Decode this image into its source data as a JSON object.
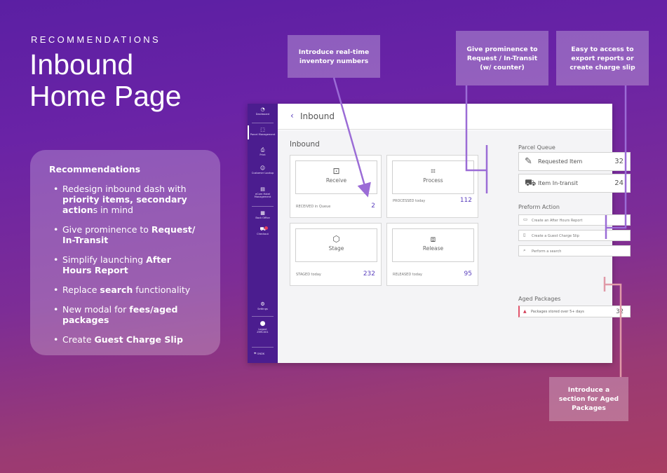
{
  "slide": {
    "eyebrow": "RECOMMENDATIONS",
    "title_line1": "Inbound",
    "title_line2": "Home Page"
  },
  "recommendations": {
    "heading": "Recommendations",
    "items": [
      {
        "pre": "Redesign inbound dash with ",
        "bold": "priority items, secondary action",
        "post": "s in mind"
      },
      {
        "pre": "Give prominence to ",
        "bold": "Request/ In-Transit",
        "post": ""
      },
      {
        "pre": "Simplify launching ",
        "bold": "After Hours Report",
        "post": ""
      },
      {
        "pre": "Replace ",
        "bold": "search",
        "post": " functionality"
      },
      {
        "pre": "New modal for ",
        "bold": "fees/aged packages",
        "post": ""
      },
      {
        "pre": "Create ",
        "bold": "Guest Charge Slip",
        "post": ""
      }
    ]
  },
  "callouts": {
    "realtime": "Introduce real-time inventory numbers",
    "prominence": "Give prominence to Request / In-Transit (w/ counter)",
    "export": "Easy to access to export reports or create charge slip",
    "aged": "Introduce a section for Aged Packages"
  },
  "app": {
    "sidebar": [
      {
        "label": "Dashboard",
        "icon": "dashboard-icon",
        "glyph": "◔"
      },
      {
        "label": "Parcel Management",
        "icon": "parcel-icon",
        "glyph": "⬚"
      },
      {
        "label": "Print",
        "icon": "print-icon",
        "glyph": "⎙"
      },
      {
        "label": "Customer Lookup",
        "icon": "customer-icon",
        "glyph": "☺"
      },
      {
        "label": "eCom Hotel Management",
        "icon": "hotel-icon",
        "glyph": "▤"
      },
      {
        "label": "Back Office",
        "icon": "back-office-icon",
        "glyph": "▦"
      },
      {
        "label": "Checkout",
        "icon": "cart-icon",
        "glyph": "⛟"
      },
      {
        "label": "Settings",
        "icon": "settings-icon",
        "glyph": "⚙"
      },
      {
        "label": "Logout",
        "icon": "avatar-icon",
        "glyph": "●"
      },
      {
        "label": "ONDK",
        "icon": "location-icon",
        "glyph": "⌖"
      }
    ],
    "logout_user": "ZERC001",
    "topbar_title": "Inbound",
    "inbound_heading": "Inbound",
    "cards": [
      {
        "label": "Receive",
        "footer": "RECEIVED in Queue",
        "count": "2",
        "icon": "receive-icon",
        "glyph": "⊡"
      },
      {
        "label": "Process",
        "footer": "PROCESSED today",
        "count": "112",
        "icon": "scan-icon",
        "glyph": "⌗"
      },
      {
        "label": "Stage",
        "footer": "STAGED today",
        "count": "232",
        "icon": "box-icon",
        "glyph": "⬡"
      },
      {
        "label": "Release",
        "footer": "RELEASED today",
        "count": "95",
        "icon": "package-release-icon",
        "glyph": "⧈"
      }
    ],
    "parcel_queue": {
      "heading": "Parcel Queue",
      "requested_label": "Requested Item",
      "requested_count": "32",
      "intransit_label": "Item In-transit",
      "intransit_count": "24"
    },
    "preform_action": {
      "heading": "Preform Action",
      "actions": [
        "Create an After Hours Report",
        "Create a Guest Charge Slip",
        "Perform a search"
      ]
    },
    "aged_packages": {
      "heading": "Aged Packages",
      "row_label": "Packages stored over 5+ days",
      "count": "32"
    }
  },
  "colors": {
    "accent": "#5a3fbd",
    "sidebar": "#4b1d8f",
    "callout_line": "#9b6cd6",
    "alert": "#e2536b"
  }
}
